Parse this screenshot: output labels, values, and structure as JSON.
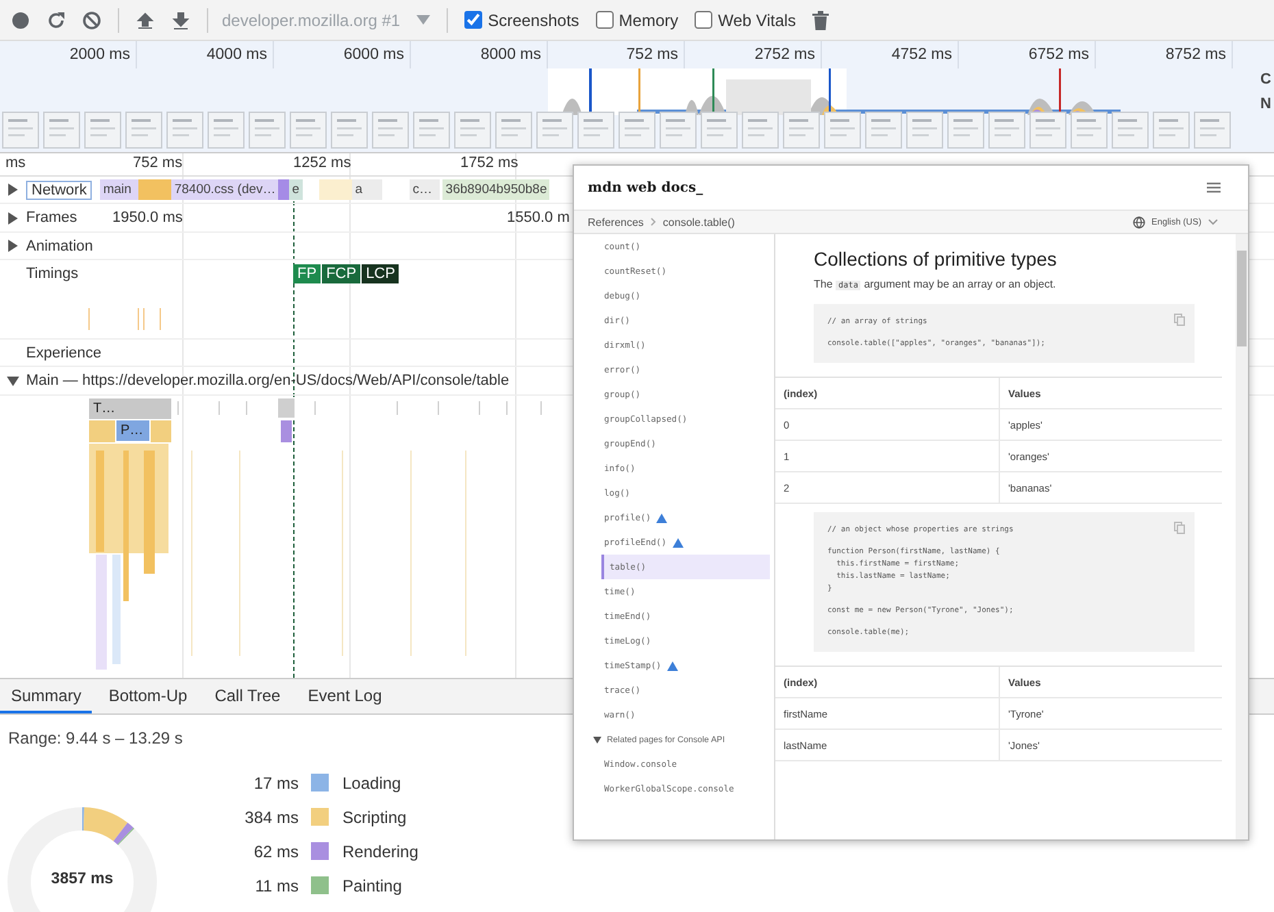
{
  "toolbar": {
    "target": "developer.mozilla.org #1",
    "checkboxes": [
      {
        "label": "Screenshots",
        "checked": true
      },
      {
        "label": "Memory",
        "checked": false
      },
      {
        "label": "Web Vitals",
        "checked": false
      }
    ]
  },
  "overview": {
    "ticks": [
      "2000 ms",
      "4000 ms",
      "6000 ms",
      "8000 ms",
      "752 ms",
      "2752 ms",
      "4752 ms",
      "6752 ms",
      "8752 ms"
    ],
    "lane_labels": [
      "C",
      "N"
    ]
  },
  "ruler": {
    "ticks": [
      "ms",
      "752 ms",
      "1252 ms",
      "1752 ms"
    ]
  },
  "tracks": [
    {
      "label": "Network",
      "kind": "network",
      "expanded": false,
      "bars": [
        {
          "label": "main",
          "color": "#ddd5f6"
        },
        {
          "color": "#f2c160"
        },
        {
          "label": "78400.css (dev…",
          "color": "#ddd5f6"
        },
        {
          "color": "#a58be6"
        },
        {
          "label": "e",
          "color": "#cfe3dc"
        },
        {
          "color": "#fbefcf"
        },
        {
          "label": "a",
          "color": "#ececec"
        },
        {
          "label": "c…",
          "color": "#ececec"
        },
        {
          "label": "36b8904b950b8e",
          "color": "#dcebd6"
        }
      ]
    },
    {
      "label": "Frames",
      "kind": "frames",
      "expanded": false,
      "readings": [
        "1950.0 ms",
        "1550.0 m"
      ]
    },
    {
      "label": "Animation",
      "kind": "plain",
      "expanded": false
    },
    {
      "label": "Timings",
      "kind": "timings",
      "markers": [
        "FP",
        "FCP",
        "LCP"
      ]
    },
    {
      "label": "Experience",
      "kind": "plain"
    },
    {
      "label": "Main — https://developer.mozilla.org/en-US/docs/Web/API/console/table",
      "kind": "main",
      "expanded": true
    }
  ],
  "flame_blocks": [
    {
      "label": "T…",
      "color": "#c8c8c8"
    },
    {
      "label": "P…",
      "color": "#7fa6e0"
    }
  ],
  "popup": {
    "logo": "mdn web docs_",
    "breadcrumb": [
      "References",
      "console.table()"
    ],
    "language": "English (US)",
    "sidebar": [
      {
        "label": "count()",
        "warning": false,
        "selected": false
      },
      {
        "label": "countReset()",
        "warning": false,
        "selected": false
      },
      {
        "label": "debug()",
        "warning": false,
        "selected": false
      },
      {
        "label": "dir()",
        "warning": false,
        "selected": false
      },
      {
        "label": "dirxml()",
        "warning": false,
        "selected": false
      },
      {
        "label": "error()",
        "warning": false,
        "selected": false
      },
      {
        "label": "group()",
        "warning": false,
        "selected": false
      },
      {
        "label": "groupCollapsed()",
        "warning": false,
        "selected": false
      },
      {
        "label": "groupEnd()",
        "warning": false,
        "selected": false
      },
      {
        "label": "info()",
        "warning": false,
        "selected": false
      },
      {
        "label": "log()",
        "warning": false,
        "selected": false
      },
      {
        "label": "profile()",
        "warning": true,
        "selected": false
      },
      {
        "label": "profileEnd()",
        "warning": true,
        "selected": false
      },
      {
        "label": "table()",
        "warning": false,
        "selected": true
      },
      {
        "label": "time()",
        "warning": false,
        "selected": false
      },
      {
        "label": "timeEnd()",
        "warning": false,
        "selected": false
      },
      {
        "label": "timeLog()",
        "warning": false,
        "selected": false
      },
      {
        "label": "timeStamp()",
        "warning": true,
        "selected": false
      },
      {
        "label": "trace()",
        "warning": false,
        "selected": false
      },
      {
        "label": "warn()",
        "warning": false,
        "selected": false
      }
    ],
    "related": {
      "title": "Related pages for Console API",
      "expanded": true,
      "items": [
        "Window.console",
        "WorkerGlobalScope.console"
      ]
    },
    "content": [
      {
        "kind": "heading",
        "text": "Collections of primitive types"
      },
      {
        "kind": "paragraph",
        "before": "The",
        "code": "data",
        "after": "argument may be an array or an object."
      },
      {
        "kind": "code",
        "groups": [
          [
            "// an array of strings"
          ],
          [
            "console.table([\"apples\", \"oranges\", \"bananas\"]);"
          ]
        ]
      },
      {
        "kind": "table",
        "columns": [
          "(index)",
          "Values"
        ],
        "rows": [
          [
            "0",
            "'apples'"
          ],
          [
            "1",
            "'oranges'"
          ],
          [
            "2",
            "'bananas'"
          ]
        ]
      },
      {
        "kind": "code",
        "groups": [
          [
            "// an object whose properties are strings"
          ],
          [
            "function Person(firstName, lastName) {",
            "  this.firstName = firstName;",
            "  this.lastName = lastName;",
            "}"
          ],
          [
            "const me = new Person(\"Tyrone\", \"Jones\");"
          ],
          [
            "console.table(me);"
          ]
        ]
      },
      {
        "kind": "table",
        "columns": [
          "(index)",
          "Values"
        ],
        "rows": [
          [
            "firstName",
            "'Tyrone'"
          ],
          [
            "lastName",
            "'Jones'"
          ]
        ]
      }
    ]
  },
  "summary": {
    "tabs": [
      {
        "label": "Summary",
        "selected": true
      },
      {
        "label": "Bottom-Up",
        "selected": false
      },
      {
        "label": "Call Tree",
        "selected": false
      },
      {
        "label": "Event Log",
        "selected": false
      }
    ],
    "range": "Range: 9.44 s – 13.29 s",
    "total": "3857 ms",
    "categories": [
      {
        "value": "17 ms",
        "label": "Loading",
        "color": "#8cb4e6"
      },
      {
        "value": "384 ms",
        "label": "Scripting",
        "color": "#f2cf7f"
      },
      {
        "value": "62 ms",
        "label": "Rendering",
        "color": "#a98fe0"
      },
      {
        "value": "11 ms",
        "label": "Painting",
        "color": "#8fc08b"
      }
    ]
  }
}
